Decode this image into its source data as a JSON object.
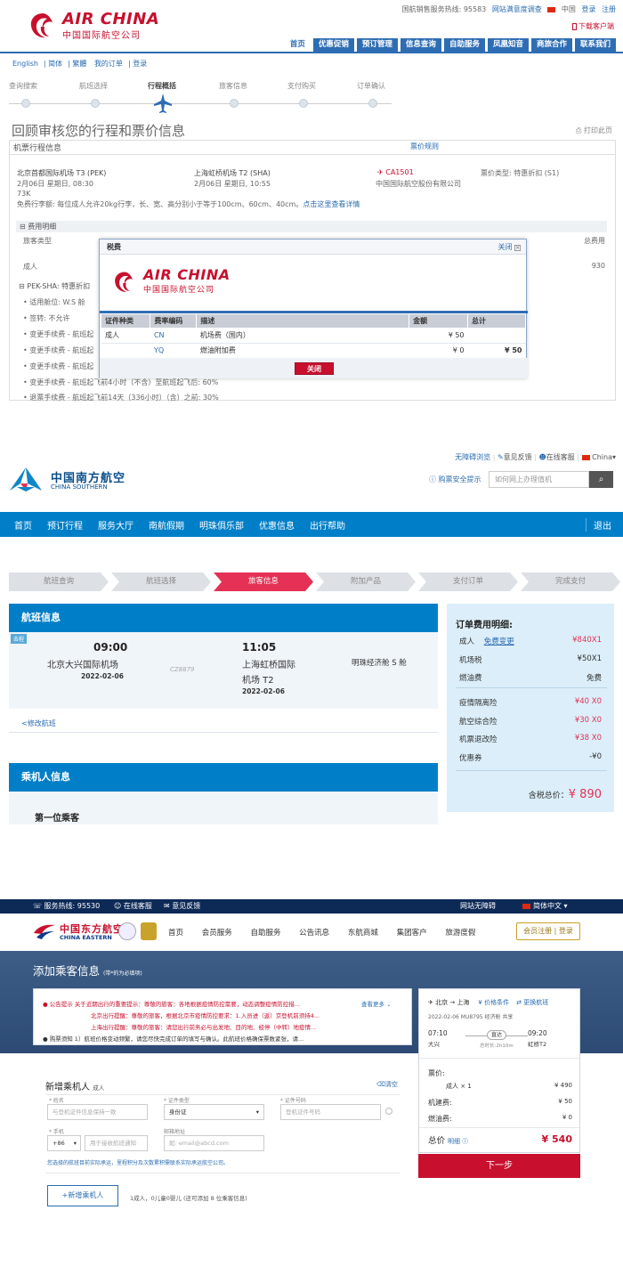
{
  "air_china": {
    "logo_en": "AIR CHINA",
    "logo_cn": "中国国际航空公司",
    "hotline": "国航销售服务热线: 95583",
    "survey": "网站满意度调查",
    "region": "中国",
    "login": "登录",
    "register": "注册",
    "download": "下载客户端",
    "nav": [
      "首页",
      "优惠促销",
      "预订管理",
      "信息查询",
      "自助服务",
      "凤凰知音",
      "商旅合作",
      "联系我们"
    ],
    "langs": [
      "English",
      "简体",
      "繁體",
      "我的订单",
      "登录"
    ],
    "steps": [
      "查询搜索",
      "航班选择",
      "行程概括",
      "旅客信息",
      "支付购买",
      "订单确认"
    ],
    "page_title": "回顾审核您的行程和票价信息",
    "print": "打印此页",
    "section_title": "机票行程信息",
    "fare_rules": "票价规则",
    "dep_airport": "北京首都国际机场 T3 (PEK)",
    "dep_time": "2月06日 星期日, 08:30",
    "aircraft": "73K",
    "arr_airport": "上海虹桥机场 T2 (SHA)",
    "arr_time": "2月06日 星期日, 10:55",
    "flight_no": "CA1501",
    "carrier": "中国国际航空股份有限公司",
    "fare_type": "票价类型: 特惠折扣 (S1)",
    "baggage": "免费行李额: 每位成人允许20kg行李，长、宽、高分别小于等于100cm、60cm、40cm。",
    "baggage_link": "点击这里查看详情",
    "fee_detail": "费用明细",
    "pax_type_header": "旅客类型",
    "total_header": "总费用",
    "pax_adult": "成人",
    "total_value": "930",
    "route_label": "PEK-SHA: 特惠折扣",
    "rules": [
      "适用舱位: W.S 舱",
      "签转: 不允许",
      "变更手续费 - 航班起",
      "变更手续费 - 航班起",
      "变更手续费 - 航班起",
      "变更手续费 - 航班起飞前4小时（不含）至航班起飞后: 60%",
      "退票手续费 - 航班起飞前14天（336小时）（含）之前: 30%"
    ],
    "modal": {
      "title": "税费",
      "close": "关闭",
      "headers": [
        "证件种类",
        "费率编码",
        "描述",
        "金额",
        "总计"
      ],
      "rows": [
        {
          "type": "成人",
          "code": "CN",
          "desc": "机场费（国内）",
          "amount": "¥ 50",
          "total": ""
        },
        {
          "type": "",
          "code": "YQ",
          "desc": "燃油附加费",
          "amount": "¥ 0",
          "total": "¥ 50"
        }
      ],
      "button": "关闭"
    }
  },
  "china_southern": {
    "logo_cn": "中国南方航空",
    "logo_en": "CHINA SOUTHERN",
    "top_links": [
      "无障碍浏览",
      "意见反馈",
      "在线客服",
      "China"
    ],
    "security": "购票安全提示",
    "search_placeholder": "如何网上办理值机",
    "nav": [
      "首页",
      "预订行程",
      "服务大厅",
      "南航假期",
      "明珠俱乐部",
      "优惠信息",
      "出行帮助"
    ],
    "logout": "退出",
    "steps": [
      "航班查询",
      "航班选择",
      "旅客信息",
      "附加产品",
      "支付订单",
      "完成支付"
    ],
    "flight_title": "航班信息",
    "go": "去程",
    "dep_time": "09:00",
    "dep_airport": "北京大兴国际机场",
    "dep_date": "2022-02-06",
    "flight_no": "CZ8879",
    "arr_time": "11:05",
    "arr_airport_1": "上海虹桥国际",
    "arr_airport_2": "机场 T2",
    "arr_date": "2022-02-06",
    "cabin": "明珠经济舱 S 舱",
    "modify": "<修改航班",
    "pax_title": "乘机人信息",
    "first_pax": "第一位乘客",
    "fee_title": "订单费用明细:",
    "fees": [
      {
        "label": "成人",
        "extra": "免费变更",
        "value": "¥840X1"
      },
      {
        "label": "机场税",
        "extra": "",
        "value": "¥50X1"
      },
      {
        "label": "燃油费",
        "extra": "",
        "value": "免费"
      },
      {
        "label": "疫情隔离险",
        "extra": "",
        "value": "¥40 X0"
      },
      {
        "label": "航空综合险",
        "extra": "",
        "value": "¥30 X0"
      },
      {
        "label": "机票退改险",
        "extra": "",
        "value": "¥38 X0"
      },
      {
        "label": "优惠券",
        "extra": "",
        "value": "-¥0"
      }
    ],
    "total_label": "含税总价：",
    "total_value": "¥ 890"
  },
  "china_eastern": {
    "hotline": "服务热线: 95530",
    "online": "在线客服",
    "feedback": "意见反馈",
    "accessible": "网站无障碍",
    "lang": "简体中文",
    "logo_cn": "中国东方航空",
    "logo_en": "CHINA EASTERN",
    "nav": [
      "首页",
      "会员服务",
      "自助服务",
      "公告讯息",
      "东航商城",
      "集团客户",
      "旅游度假"
    ],
    "member": "会员注册 | 登录",
    "title": "添加乘客信息",
    "title_note": "(带*的为必填项)",
    "notices": [
      "● 公告提示  关于近期出行的重要提示：尊敬的旅客：各地根据疫情防控需要，动态调整疫情防控措...",
      "北京出行提醒：尊敬的旅客，根据北京市疫情防控要求：1.入员进（返）京登机前须持4...",
      "上海出行提醒：尊敬的旅客：请您出行前务必与出发地、目的地、经停（中转）地疫情...",
      "● 购票须知  1）航班价格变动频繁，请您尽快完成订单的填写与确认。此航班价格确保票数紧张，请..."
    ],
    "more": "查看更多",
    "new_pax": "新增乘机人",
    "adult": "成人",
    "clear": "清空",
    "name_label": "* 姓名",
    "name_ph": "与登机证件信息保持一致",
    "idtype_label": "* 证件类型",
    "idtype_value": "身份证",
    "idno_label": "* 证件号码",
    "idno_ph": "登机证件号码",
    "phone_label": "* 手机",
    "cc": "+86",
    "phone_ph": "用于接收航班通知",
    "email_label": "邮箱地址",
    "email_ph": "如: email@abcd.com",
    "hint": "您选择的航班目前实际承运，里程积分及次数累积需联系实际承运航空公司。",
    "add_btn": "+新增乘机人",
    "count": "1成人，0儿童0婴儿   (还可添加 8 位乘客信息)",
    "route": "北京 → 上海",
    "price_cond": "价格条件",
    "change": "更换航班",
    "date_info": "2022-02-06  MU8795  经济舱  共享",
    "dep_time": "07:10",
    "dep_city": "大兴",
    "direct": "直达",
    "duration": "总时长:2h10m",
    "arr_time": "09:20",
    "arr_city": "虹桥T2",
    "ticket": "票价:",
    "adult_x": "成人 × 1",
    "adult_price": "¥ 490",
    "airport_fee": "机建费:",
    "airport_val": "¥ 50",
    "fuel": "燃油费:",
    "fuel_val": "¥ 0",
    "total_label": "总价",
    "detail": "明细",
    "total_value": "¥ 540",
    "next": "下一步"
  }
}
